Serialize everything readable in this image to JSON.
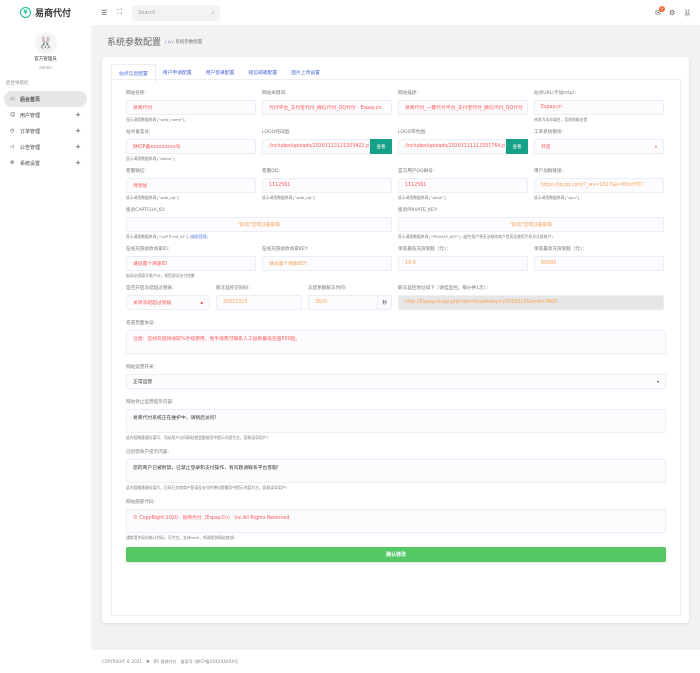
{
  "app": {
    "name": "易商代付"
  },
  "topbar": {
    "search_placeholder": "Search",
    "notification_count": "0"
  },
  "user": {
    "name": "官方管理员",
    "role": "admin"
  },
  "sidebar": {
    "title": "后台导航栏",
    "items": [
      {
        "label": "后台首页",
        "icon": "monitor-icon",
        "active": true
      },
      {
        "label": "用户管理",
        "icon": "user-icon"
      },
      {
        "label": "订单管理",
        "icon": "clock-icon"
      },
      {
        "label": "公告管理",
        "icon": "megaphone-icon"
      },
      {
        "label": "系统设置",
        "icon": "gear-icon"
      }
    ]
  },
  "page": {
    "title": "系统参数配置",
    "breadcrumb_current": "系统参数配置"
  },
  "tabs": [
    "站点信息配置",
    "用户申请配置",
    "用户登录配置",
    "短信邮箱配置",
    "图片上传设置"
  ],
  "form": {
    "web_name": {
      "label": "网站名称:",
      "value": "易商代付",
      "help": "显示调用数据库表{\"web_name\"}"
    },
    "keywords": {
      "label": "网站关键词:",
      "value": "代付平台_支付宝代付_微信代付_QQ代付 - Espay.cn"
    },
    "description": {
      "label": "网站描述:",
      "value": "易商代付_一键代付平台_支付宝代付_微信代付_QQ代付"
    },
    "site_url": {
      "label": "站点URL(不加http):",
      "value": "Espay.cn",
      "help": "修改为本站域名，否则前缀出错"
    },
    "beian": {
      "label": "站点备案号:",
      "value": "陕ICP备xxxxxxxxx号",
      "help": "显示调用数据库表{\"beian\"}"
    },
    "logo_white": {
      "label": "LOGO纯白图:",
      "value": "/includes/uploads/20201113121203422.p",
      "btn": "查看"
    },
    "logo_color": {
      "label": "LOGO带色图:",
      "value": "/includes/uploads/20201111112331764.p",
      "btn": "查看"
    },
    "ticket": {
      "label": "工单系统模块:",
      "value": "开启"
    },
    "service_wx": {
      "label": "客服微信:",
      "value": "待添加",
      "help": "显示调用数据库表{\"web_qq\"}"
    },
    "service_qq": {
      "label": "客服QQ:",
      "value": "1112561",
      "help": "显示调用数据库表{\"web_qq\"}"
    },
    "qq_group": {
      "label": "官方用户QQ群号:",
      "value": "1112561",
      "help": "显示调用数据库表{\"qhqh\"}"
    },
    "group_link": {
      "label": "用户加群链接:",
      "value": "https://jq.qq.com/?_wv=1027&k=M1nHTCl",
      "help": "显示调用数据库表{\"qun\"}"
    },
    "captcha_id": {
      "label": "极验CAPTCHA_ID:",
      "value": "\"极验\"官网注册获取",
      "help": "显示调用数据库表{\"CAPTCHA_ID\"}",
      "help_link": "(极验官网)"
    },
    "private_key": {
      "label": "极验PRIVATE_KEY:",
      "value": "\"极验\"官网注册获取",
      "help": "显示调用数据库表{\"PRIVATE_KEY\"} (留空用户将无法修改商户信息及使用手机号注册商户)"
    },
    "pay_id": {
      "label": "在线充值收款商家ID:",
      "value": "请设置个商家ID",
      "help": "起诉必须填写商户ID，祝您测试支付完美"
    },
    "pay_key": {
      "label": "在线充值收款商家KEY:",
      "value": "请设置个商家KEY"
    },
    "min_recharge": {
      "label": "单笔最低充值限额（元）：",
      "value": "19.9"
    },
    "max_recharge": {
      "label": "单笔最高充值限额（元）：",
      "value": "60000"
    },
    "freeze": {
      "label": "是否开启冻结超过到账:",
      "value": "关闭冻结超过到账"
    },
    "unfreeze_key": {
      "label": "解冻监控识别码:",
      "value": "20010325"
    },
    "freeze_time": {
      "label": "冻结余额解冻时间:",
      "value": "3600",
      "unit": "秒"
    },
    "monitor_url": {
      "label": "解冻监控地址如下（请挂监控，每分钟1次）：",
      "value": "http://Espay.cn/api.php?act=thaw&key=20010325&limit=3600"
    },
    "agreement": {
      "label": "充值页面协议:",
      "value": "注意：在线充值将收取%手续费用，免手续费可联系人工加款最低充值500起。"
    },
    "switch": {
      "label": "网站运营开关:",
      "value": "正常运营"
    },
    "stop_tip": {
      "label": "网站停止运营提示内容:",
      "value": "易商代付系统正在维护中，请稍后访问!",
      "help": "此内容随意建议填写，而站用户访问网站就会跟前页中提示内容为主，容易误导用户!"
    },
    "ban_tip": {
      "label": "已封禁商户提示内容:",
      "value": "您的商户已被封禁，已禁止登录和支付操作，有问题请联系平台客服!",
      "help": "此内容随意建议填写，后续已封禁商户登录及支付时弹出提醒页中提示内容为主，容易误导用户!"
    },
    "footer_code": {
      "label": "网站底部代码:",
      "value": "© CopyRight 2020 · 易商代付（Espay.Cn） Inc.All Rights Reserved.",
      "help": "通常用作网站统计代码，可为空，支持html，将调用到网站底部!"
    },
    "submit": "确认修改"
  },
  "footer": {
    "copyright": "COPYRIGHT © 2021",
    "by": "BY: 易商代付",
    "beian": "备案号: 陕ICP备XXXXXXXXX号"
  }
}
